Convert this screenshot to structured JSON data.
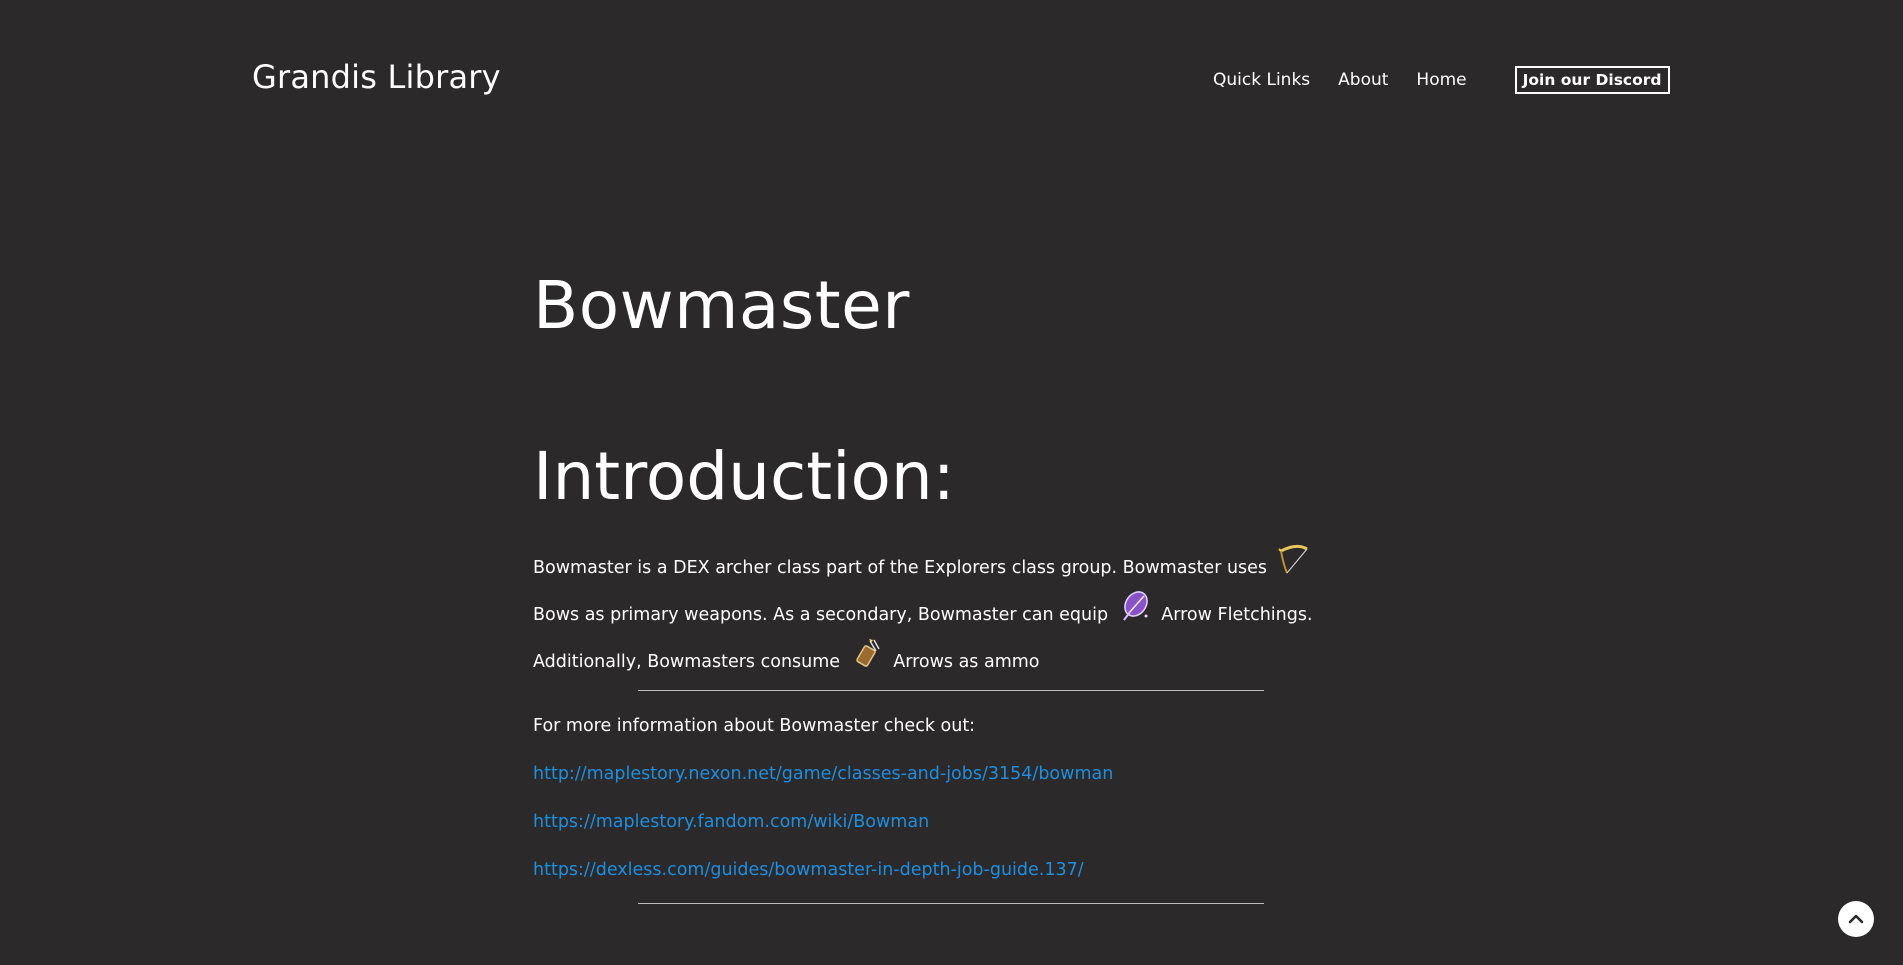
{
  "header": {
    "site_title": "Grandis Library",
    "nav": [
      {
        "label": "Quick Links"
      },
      {
        "label": "About"
      },
      {
        "label": "Home"
      }
    ],
    "discord_button": "Join our Discord"
  },
  "main": {
    "page_title": "Bowmaster",
    "section_title": "Introduction:",
    "intro": {
      "part1": "Bowmaster is a DEX archer class part of the Explorers class group. Bowmaster uses",
      "icon1": "bow-icon",
      "part2": "Bows as primary weapons. As a secondary, Bowmaster can equip",
      "icon2": "arrow-fletching-icon",
      "part3": "Arrow Fletchings. Additionally, Bowmasters consume",
      "icon3": "arrows-icon",
      "part4": "Arrows as ammo"
    },
    "more_info_label": "For more information about Bowmaster check out:",
    "links": [
      "http://maplestory.nexon.net/game/classes-and-jobs/3154/bowman",
      "https://maplestory.fandom.com/wiki/Bowman",
      "https://dexless.com/guides/bowmaster-in-depth-job-guide.137/"
    ]
  },
  "scroll_top_icon": "chevron-up-icon",
  "colors": {
    "background": "#2b292a",
    "text": "#ffffff",
    "link": "#1d8fe0",
    "divider": "#bdbdbd"
  }
}
